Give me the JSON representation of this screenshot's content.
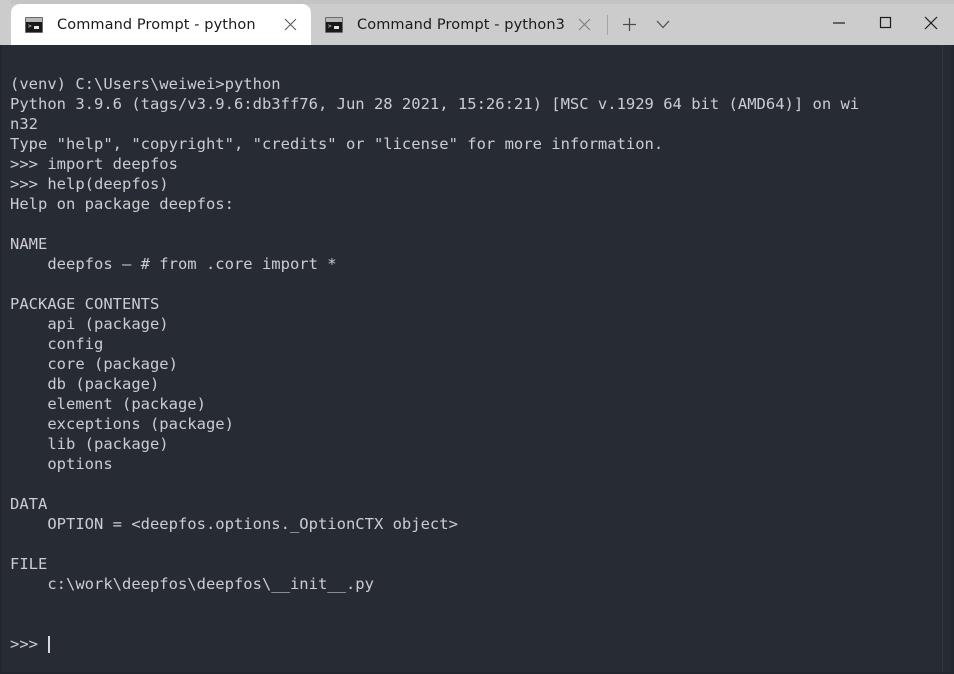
{
  "window": {
    "tabs": [
      {
        "title": "Command Prompt - python",
        "icon": "console-icon",
        "active": true,
        "close_icon": "close-icon"
      },
      {
        "title": "Command Prompt - python3",
        "icon": "console-icon",
        "active": false,
        "close_icon": "close-icon"
      }
    ],
    "new_tab_icon": "plus-icon",
    "dropdown_icon": "chevron-down-icon",
    "controls": {
      "minimize_icon": "minimize-icon",
      "maximize_icon": "maximize-icon",
      "close_icon": "close-icon"
    },
    "colors": {
      "titlebar_bg": "#cccccc",
      "active_tab_bg": "#ffffff",
      "terminal_bg": "#272b33",
      "terminal_fg": "#ccccd1",
      "cursor": "#d8d8dc"
    }
  },
  "terminal": {
    "lines": [
      "(venv) C:\\Users\\weiwei>python",
      "Python 3.9.6 (tags/v3.9.6:db3ff76, Jun 28 2021, 15:26:21) [MSC v.1929 64 bit (AMD64)] on wi",
      "n32",
      "Type \"help\", \"copyright\", \"credits\" or \"license\" for more information.",
      ">>> import deepfos",
      ">>> help(deepfos)",
      "Help on package deepfos:",
      "",
      "NAME",
      "    deepfos — # from .core import *",
      "",
      "PACKAGE CONTENTS",
      "    api (package)",
      "    config",
      "    core (package)",
      "    db (package)",
      "    element (package)",
      "    exceptions (package)",
      "    lib (package)",
      "    options",
      "",
      "DATA",
      "    OPTION = <deepfos.options._OptionCTX object>",
      "",
      "FILE",
      "    c:\\work\\deepfos\\deepfos\\__init__.py",
      "",
      ""
    ],
    "prompt": ">>>",
    "cursor_visible": true
  }
}
